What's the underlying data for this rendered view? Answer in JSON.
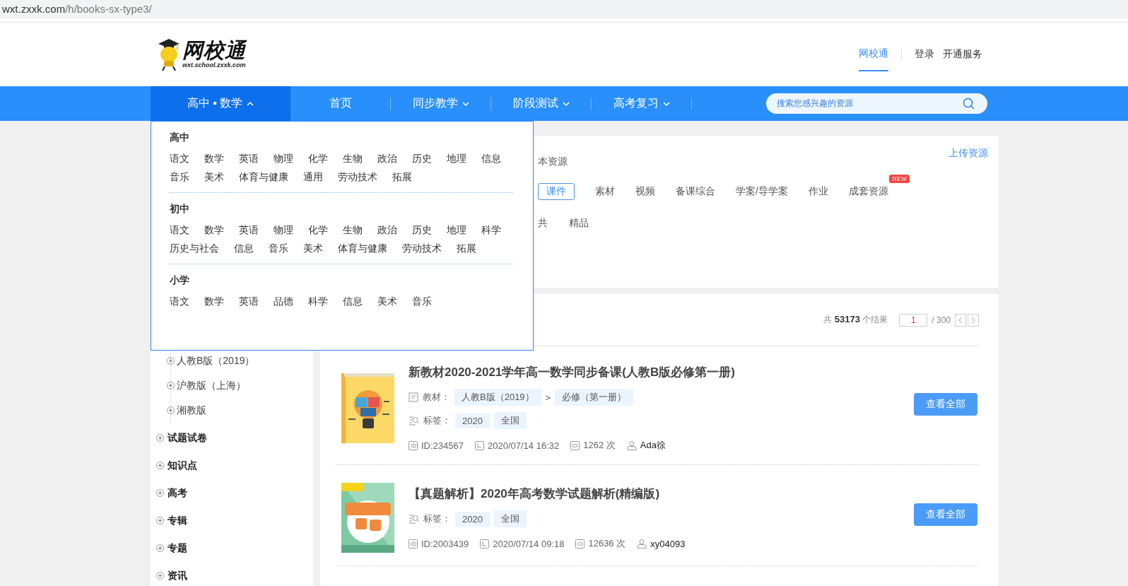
{
  "browser": {
    "url_host": "wxt.zxxk.com",
    "url_path": "/h/books-sx-type3/"
  },
  "header": {
    "logo": {
      "name": "网校通",
      "domain": "wxt.school.zxxk.com"
    },
    "links": [
      {
        "label": "网校通",
        "selected": true
      },
      {
        "label": "登录",
        "selected": false
      },
      {
        "label": "开通服务",
        "selected": false
      }
    ]
  },
  "nav": {
    "items": [
      {
        "label": "高中 ▪ 数学",
        "selected": true,
        "has_menu": true,
        "expanded": true
      },
      {
        "label": "首页",
        "selected": false,
        "has_menu": false
      },
      {
        "label": "同步教学",
        "selected": false,
        "has_menu": true,
        "expanded": false
      },
      {
        "label": "阶段测试",
        "selected": false,
        "has_menu": true,
        "expanded": false
      },
      {
        "label": "高考复习",
        "selected": false,
        "has_menu": true,
        "expanded": false
      }
    ],
    "search": {
      "placeholder": "搜索您感兴趣的资源"
    }
  },
  "subject_menu": {
    "sections": [
      {
        "title": "高中",
        "subjects": [
          "语文",
          "数学",
          "英语",
          "物理",
          "化学",
          "生物",
          "政治",
          "历史",
          "地理",
          "信息",
          "音乐",
          "美术",
          "体育与健康",
          "通用",
          "劳动技术",
          "拓展"
        ]
      },
      {
        "title": "初中",
        "subjects": [
          "语文",
          "数学",
          "英语",
          "物理",
          "化学",
          "生物",
          "政治",
          "历史",
          "地理",
          "科学",
          "历史与社会",
          "信息",
          "音乐",
          "美术",
          "体育与健康",
          "劳动技术",
          "拓展"
        ]
      },
      {
        "title": "小学",
        "subjects": [
          "语文",
          "数学",
          "英语",
          "品德",
          "科学",
          "信息",
          "美术",
          "音乐"
        ]
      }
    ]
  },
  "sidebar": {
    "versions": [
      {
        "label": "人教B版（2019）",
        "expanded": false
      },
      {
        "label": "沪教版（上海）",
        "expanded": false
      },
      {
        "label": "湘教版",
        "expanded": false
      }
    ],
    "categories": [
      {
        "label": "试题试卷",
        "expanded": false
      },
      {
        "label": "知识点",
        "expanded": false
      },
      {
        "label": "高考",
        "expanded": false
      },
      {
        "label": "专辑",
        "expanded": false
      },
      {
        "label": "专题",
        "expanded": false
      },
      {
        "label": "资讯",
        "expanded": false
      }
    ]
  },
  "filters": {
    "scope_label": "本资源",
    "upload_link": "上传资源",
    "types": [
      {
        "label": "课件",
        "selected": true
      },
      {
        "label": "素材",
        "selected": false
      },
      {
        "label": "视频",
        "selected": false
      },
      {
        "label": "备课综合",
        "selected": false
      },
      {
        "label": "学案/导学案",
        "selected": false
      },
      {
        "label": "作业",
        "selected": false
      },
      {
        "label": "成套资源",
        "selected": false,
        "badge": "NEW"
      }
    ],
    "quality": [
      "共",
      "精品"
    ]
  },
  "results": {
    "total_prefix": "共",
    "total": "53173",
    "total_suffix": "个结果",
    "page": "1",
    "page_count": "/ 300",
    "items": [
      {
        "title": "新教材2020-2021学年高一数学同步备课(人教B版必修第一册)",
        "textbook": {
          "label": "教材：",
          "path": [
            "人教B版（2019）",
            "必修（第一册）"
          ],
          "separator": ">"
        },
        "tags": {
          "label": "标签：",
          "values": [
            "2020",
            "全国"
          ]
        },
        "meta": {
          "id": "ID:234567",
          "date": "2020/07/14 16:32",
          "views": "1262 次",
          "author": "Ada徐"
        },
        "button": "查看全部"
      },
      {
        "title": "【真题解析】2020年高考数学试题解析(精编版)",
        "tags": {
          "label": "标签：",
          "values": [
            "2020",
            "全国"
          ]
        },
        "meta": {
          "id": "ID:2003439",
          "date": "2020/07/14 09:18",
          "views": "12636 次",
          "author": "xy04093"
        },
        "button": "查看全部"
      }
    ]
  }
}
